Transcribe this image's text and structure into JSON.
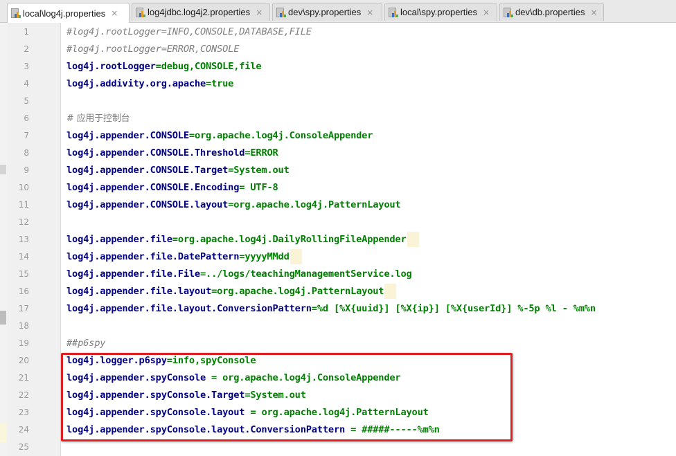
{
  "tabs": [
    {
      "label": "local\\log4j.properties",
      "active": true
    },
    {
      "label": "log4jdbc.log4j2.properties",
      "active": false
    },
    {
      "label": "dev\\spy.properties",
      "active": false
    },
    {
      "label": "local\\spy.properties",
      "active": false
    },
    {
      "label": "dev\\db.properties",
      "active": false
    }
  ],
  "close_glyph": "×",
  "icons": {
    "tab_file": "properties-file-icon",
    "close": "close-icon"
  },
  "colors": {
    "key": "#000080",
    "value": "#008000",
    "comment": "#808080",
    "highlight_box": "#e02020"
  },
  "lines": [
    {
      "n": "1",
      "type": "comment",
      "text": "#log4j.rootLogger=INFO,CONSOLE,DATABASE,FILE"
    },
    {
      "n": "2",
      "type": "comment",
      "text": "#log4j.rootLogger=ERROR,CONSOLE"
    },
    {
      "n": "3",
      "type": "prop",
      "key": "log4j.rootLogger",
      "sep": "=",
      "value": "debug,CONSOLE,file"
    },
    {
      "n": "4",
      "type": "prop",
      "key": "log4j.addivity.org.apache",
      "sep": "=",
      "value": "true"
    },
    {
      "n": "5",
      "type": "blank"
    },
    {
      "n": "6",
      "type": "comment",
      "text": "# 应用于控制台",
      "cn": true
    },
    {
      "n": "7",
      "type": "prop",
      "key": "log4j.appender.CONSOLE",
      "sep": "=",
      "value": "org.apache.log4j.ConsoleAppender"
    },
    {
      "n": "8",
      "type": "prop",
      "key": "log4j.appender.CONSOLE.Threshold",
      "sep": "=",
      "value": "ERROR"
    },
    {
      "n": "9",
      "type": "prop",
      "key": "log4j.appender.CONSOLE.Target",
      "sep": "=",
      "value": "System.out"
    },
    {
      "n": "10",
      "type": "prop",
      "key": "log4j.appender.CONSOLE.Encoding",
      "sep": "= ",
      "value": "UTF-8"
    },
    {
      "n": "11",
      "type": "prop",
      "key": "log4j.appender.CONSOLE.layout",
      "sep": "=",
      "value": "org.apache.log4j.PatternLayout"
    },
    {
      "n": "12",
      "type": "blank"
    },
    {
      "n": "13",
      "type": "prop",
      "key": "log4j.appender.file",
      "sep": "=",
      "value": "org.apache.log4j.DailyRollingFileAppender",
      "trail": true
    },
    {
      "n": "14",
      "type": "prop",
      "key": "log4j.appender.file.DatePattern",
      "sep": "=",
      "value": "yyyyMMdd",
      "trail": true
    },
    {
      "n": "15",
      "type": "prop",
      "key": "log4j.appender.file.File",
      "sep": "=",
      "value": "../logs/teachingManagementService.log"
    },
    {
      "n": "16",
      "type": "prop",
      "key": "log4j.appender.file.layout",
      "sep": "=",
      "value": "org.apache.log4j.PatternLayout",
      "trail": true
    },
    {
      "n": "17",
      "type": "prop",
      "key": "log4j.appender.file.layout.ConversionPattern",
      "sep": "=",
      "value": "%d [%X{uuid}] [%X{ip}] [%X{userId}] %-5p %l - %m%n"
    },
    {
      "n": "18",
      "type": "blank"
    },
    {
      "n": "19",
      "type": "comment",
      "text": "##p6spy"
    },
    {
      "n": "20",
      "type": "prop",
      "key": "log4j.logger.p6spy",
      "sep": "=",
      "value": "info,spyConsole"
    },
    {
      "n": "21",
      "type": "prop",
      "key": "log4j.appender.spyConsole",
      "sep": " = ",
      "value": "org.apache.log4j.ConsoleAppender"
    },
    {
      "n": "22",
      "type": "prop",
      "key": "log4j.appender.spyConsole.Target",
      "sep": "=",
      "value": "System.out"
    },
    {
      "n": "23",
      "type": "prop",
      "key": "log4j.appender.spyConsole.layout",
      "sep": " = ",
      "value": "org.apache.log4j.PatternLayout"
    },
    {
      "n": "24",
      "type": "prop",
      "key": "log4j.appender.spyConsole.layout.ConversionPattern",
      "sep": " = ",
      "value": "#####-----%m%n"
    },
    {
      "n": "25",
      "type": "blank"
    }
  ]
}
